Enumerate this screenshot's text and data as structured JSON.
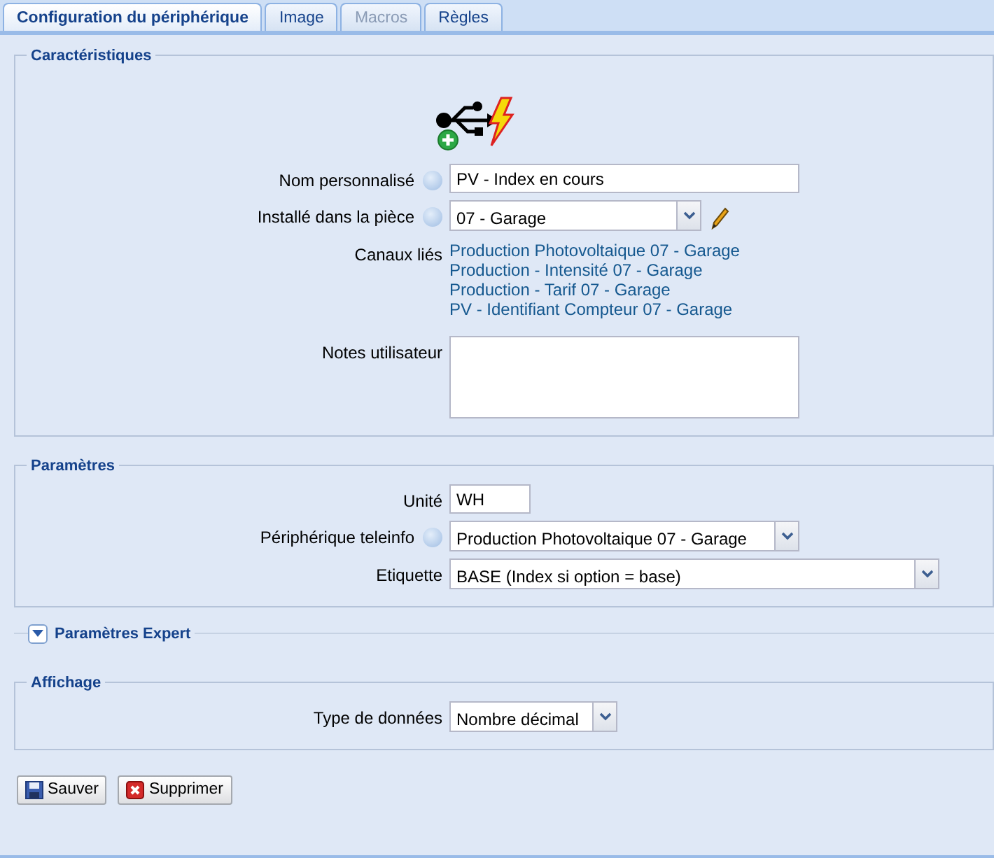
{
  "tabs": [
    {
      "label": "Configuration du périphérique",
      "selected": true,
      "disabled": false
    },
    {
      "label": "Image",
      "selected": false,
      "disabled": false
    },
    {
      "label": "Macros",
      "selected": false,
      "disabled": true
    },
    {
      "label": "Règles",
      "selected": false,
      "disabled": false
    }
  ],
  "sections": [
    {
      "kind": "fieldset",
      "title": "Caractéristiques",
      "device_icon": true,
      "fields": [
        {
          "kind": "text",
          "label": "Nom personnalisé",
          "help": true,
          "value": "PV - Index en cours"
        },
        {
          "kind": "select",
          "label": "Installé dans la pièce",
          "help": true,
          "value": "07 - Garage",
          "editable": true
        },
        {
          "kind": "links",
          "label": "Canaux liés",
          "links": [
            "Production Photovoltaique 07 - Garage",
            "Production - Intensité 07 - Garage",
            "Production - Tarif 07 - Garage",
            "PV - Identifiant Compteur 07 - Garage"
          ]
        },
        {
          "kind": "textarea",
          "label": "Notes utilisateur"
        }
      ]
    },
    {
      "kind": "fieldset",
      "title": "Paramètres",
      "fields": [
        {
          "kind": "text",
          "label": "Unité",
          "value": "WH"
        },
        {
          "kind": "select",
          "label": "Périphérique teleinfo",
          "help": true,
          "value": "Production Photovoltaique 07 - Garage"
        },
        {
          "kind": "select",
          "label": "Etiquette",
          "value": "BASE (Index si option = base)"
        }
      ]
    },
    {
      "kind": "collapsible",
      "title": "Paramètres Expert",
      "expanded": false
    },
    {
      "kind": "fieldset",
      "title": "Affichage",
      "fields": [
        {
          "kind": "select",
          "label": "Type de données",
          "value": "Nombre décimal"
        }
      ]
    }
  ],
  "buttons": [
    {
      "kind": "save",
      "label": "Sauver"
    },
    {
      "kind": "delete",
      "label": "Supprimer"
    }
  ]
}
